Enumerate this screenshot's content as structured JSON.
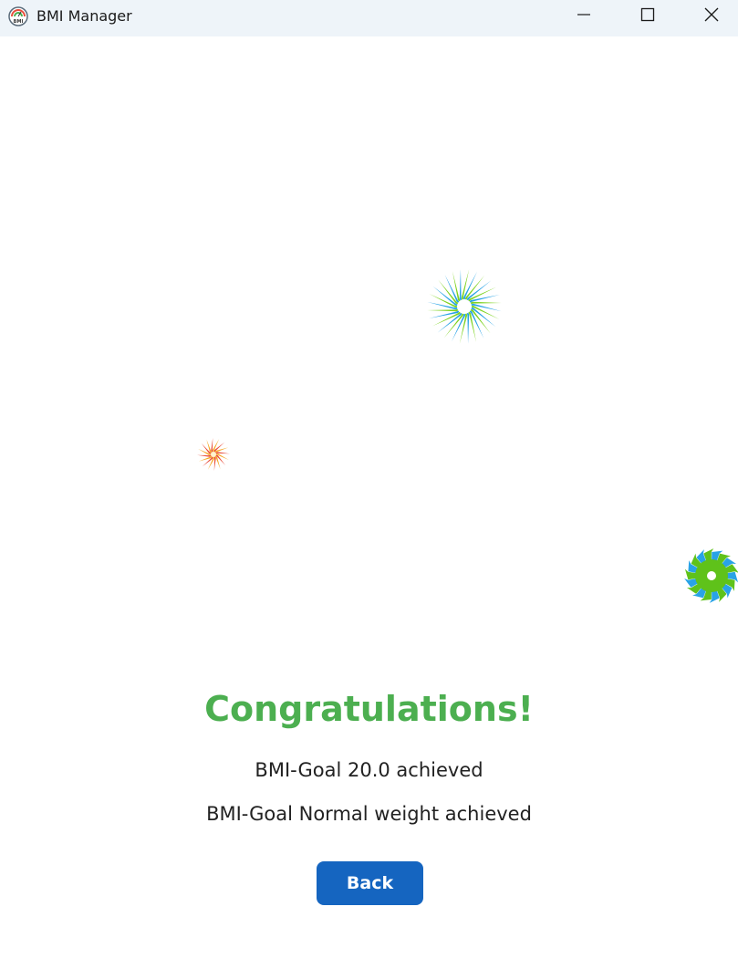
{
  "window": {
    "title": "BMI Manager",
    "icon": "bmi-logo-icon",
    "controls": {
      "minimize": "minimize-icon",
      "maximize": "maximize-icon",
      "close": "close-icon"
    }
  },
  "main": {
    "heading": "Congratulations!",
    "messages": [
      "BMI-Goal 20.0 achieved",
      "BMI-Goal Normal weight achieved"
    ],
    "back_label": "Back"
  },
  "fireworks": [
    {
      "name": "firework-large",
      "colors": [
        "#7ed321",
        "#29a3e6"
      ],
      "center": "#ffffff"
    },
    {
      "name": "firework-small",
      "colors": [
        "#f5a623",
        "#e94e3c"
      ],
      "center": "#fff2cc"
    },
    {
      "name": "firework-medium",
      "colors": [
        "#29a3e6",
        "#5fc21a"
      ],
      "center": "#ffffff"
    }
  ],
  "colors": {
    "heading": "#4caf50",
    "button": "#1565c0",
    "titlebar": "#eef4f9"
  }
}
